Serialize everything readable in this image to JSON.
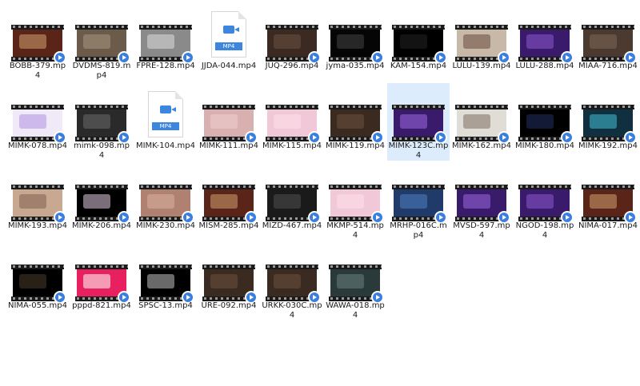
{
  "icons": {
    "video_badge": "play-badge-icon",
    "doc": "mp4-file-icon"
  },
  "colors": {
    "selection": "#dcecfc",
    "badge": "#3a7fe0"
  },
  "mp4_tag": "MP4",
  "files": [
    {
      "name": "BOBB-379.mp4",
      "type": "video",
      "bg": "#5a2418",
      "c2": "#d2a070"
    },
    {
      "name": "DVDMS-819.mp4",
      "type": "video",
      "bg": "#6b5b4a",
      "c2": "#a89880"
    },
    {
      "name": "FPRE-128.mp4",
      "type": "video",
      "bg": "#8a8a8a",
      "c2": "#dcdcdc"
    },
    {
      "name": "JJDA-044.mp4",
      "type": "doc"
    },
    {
      "name": "JUQ-296.mp4",
      "type": "video",
      "bg": "#3a2a22",
      "c2": "#6a5040"
    },
    {
      "name": "jyma-035.mp4",
      "type": "video",
      "bg": "#050505",
      "c2": "#444444"
    },
    {
      "name": "KAM-154.mp4",
      "type": "video",
      "bg": "#000000",
      "c2": "#222222"
    },
    {
      "name": "LULU-139.mp4",
      "type": "video",
      "bg": "#c8b8a8",
      "c2": "#6a4a3a"
    },
    {
      "name": "LULU-288.mp4",
      "type": "video",
      "bg": "#3a1a6a",
      "c2": "#8a5ad0"
    },
    {
      "name": "MIAA-716.mp4",
      "type": "video",
      "bg": "#4a3a30",
      "c2": "#806858"
    },
    {
      "name": "MIMK-078.mp4",
      "type": "video",
      "bg": "#f0eaf8",
      "c2": "#b090e0"
    },
    {
      "name": "mimk-098.mp4",
      "type": "video",
      "bg": "#2a2a2a",
      "c2": "#6a6a6a"
    },
    {
      "name": "MIMK-104.mp4",
      "type": "doc"
    },
    {
      "name": "MIMK-111.mp4",
      "type": "video",
      "bg": "#d8b0b0",
      "c2": "#f0d0d0"
    },
    {
      "name": "MIMK-115.mp4",
      "type": "video",
      "bg": "#f0c8d8",
      "c2": "#ffe0ea"
    },
    {
      "name": "MIMK-119.mp4",
      "type": "video",
      "bg": "#3a2a20",
      "c2": "#6a5040"
    },
    {
      "name": "MIMK-123C.mp4",
      "type": "video",
      "bg": "#3a1a6a",
      "c2": "#9a6ae0",
      "selected": true
    },
    {
      "name": "MIMK-162.mp4",
      "type": "video",
      "bg": "#e0dcd6",
      "c2": "#807060"
    },
    {
      "name": "MIMK-180.mp4",
      "type": "video",
      "bg": "#000000",
      "c2": "#203060"
    },
    {
      "name": "MIMK-192.mp4",
      "type": "video",
      "bg": "#103040",
      "c2": "#40c0d0"
    },
    {
      "name": "MIMK-193.mp4",
      "type": "video",
      "bg": "#c8a890",
      "c2": "#806050"
    },
    {
      "name": "MIMK-206.mp4",
      "type": "video",
      "bg": "#000000",
      "c2": "#e0c8e0"
    },
    {
      "name": "MIMK-230.mp4",
      "type": "video",
      "bg": "#b08070",
      "c2": "#d8b0a0"
    },
    {
      "name": "MISM-285.mp4",
      "type": "video",
      "bg": "#5a2418",
      "c2": "#d2a070"
    },
    {
      "name": "MIZD-467.mp4",
      "type": "video",
      "bg": "#1a1a1a",
      "c2": "#505050"
    },
    {
      "name": "MKMP-514.mp4",
      "type": "video",
      "bg": "#f0c8d8",
      "c2": "#ffe0ea"
    },
    {
      "name": "MRHP-016C.mp4",
      "type": "video",
      "bg": "#203a6a",
      "c2": "#5080c0"
    },
    {
      "name": "MVSD-597.mp4",
      "type": "video",
      "bg": "#3a1a6a",
      "c2": "#9a6ae0"
    },
    {
      "name": "NGOD-198.mp4",
      "type": "video",
      "bg": "#3a1a6a",
      "c2": "#8a5ad0"
    },
    {
      "name": "NIMA-017.mp4",
      "type": "video",
      "bg": "#5a2418",
      "c2": "#d2a070"
    },
    {
      "name": "NIMA-055.mp4",
      "type": "video",
      "bg": "#000000",
      "c2": "#4a3a2a"
    },
    {
      "name": "pppd-821.mp4",
      "type": "video",
      "bg": "#e82060",
      "c2": "#ffffff"
    },
    {
      "name": "SPSC-13.mp4",
      "type": "video",
      "bg": "#000000",
      "c2": "#c0c0c0"
    },
    {
      "name": "URE-092.mp4",
      "type": "video",
      "bg": "#3a2a20",
      "c2": "#6a5040"
    },
    {
      "name": "URKK-030C.mp4",
      "type": "video",
      "bg": "#3a2a20",
      "c2": "#6a5040"
    },
    {
      "name": "WAWA-018.mp4",
      "type": "video",
      "bg": "#2a3a3a",
      "c2": "#6a8080"
    }
  ]
}
